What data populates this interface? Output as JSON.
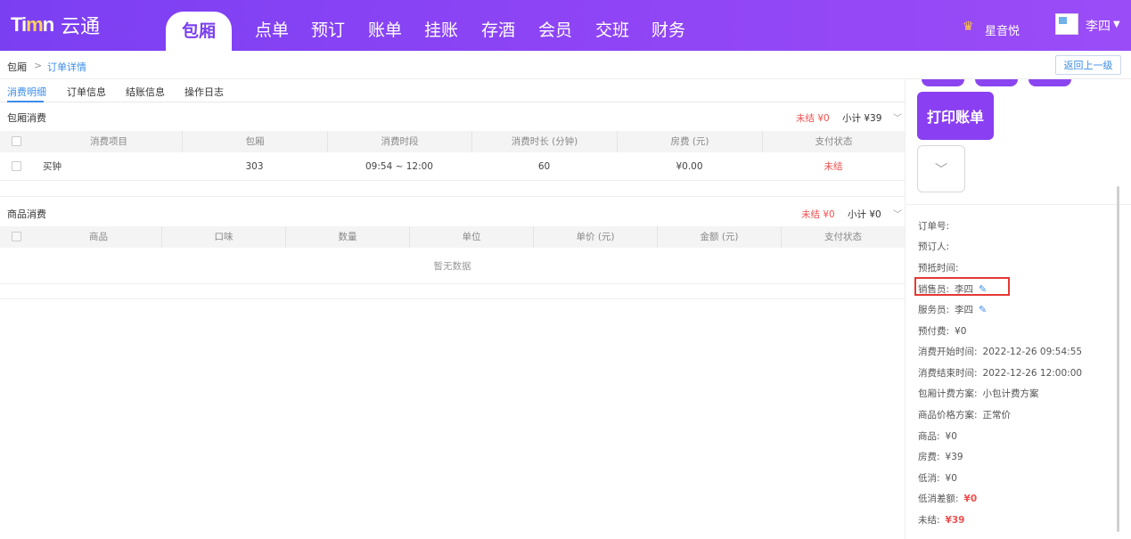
{
  "app": {
    "logo_mark_left": "Ti",
    "logo_mark_mid": "m",
    "logo_mark_right": "n",
    "logo_text": "云通",
    "nav": [
      "包厢",
      "点单",
      "预订",
      "账单",
      "挂账",
      "存酒",
      "会员",
      "交班",
      "财务"
    ],
    "active_nav": "包厢",
    "venue": "星音悦",
    "user": "李四"
  },
  "breadcrumb": {
    "root": "包厢",
    "separator": ">",
    "current": "订单详情",
    "back_label": "返回上一级"
  },
  "tabs": [
    "消费明细",
    "订单信息",
    "结账信息",
    "操作日志"
  ],
  "room_section": {
    "title": "包厢消费",
    "unsettled": "未结 ¥0",
    "subtotal": "小计 ¥39",
    "columns": [
      "消费项目",
      "包厢",
      "消费时段",
      "消费时长 (分钟)",
      "房费 (元)",
      "支付状态"
    ],
    "rows": [
      {
        "item": "买钟",
        "room": "303",
        "period": "09:54 ~ 12:00",
        "duration": "60",
        "fee": "¥0.00",
        "status": "未结"
      }
    ]
  },
  "goods_section": {
    "title": "商品消费",
    "unsettled": "未结 ¥0",
    "subtotal": "小计 ¥0",
    "columns": [
      "商品",
      "口味",
      "数量",
      "单位",
      "单价 (元)",
      "金额 (元)",
      "支付状态"
    ],
    "empty_text": "暂无数据"
  },
  "panel": {
    "print_label": "打印账单",
    "expand_glyph": "﹀",
    "info": [
      {
        "label": "订单号:",
        "value": ""
      },
      {
        "label": "预订人:",
        "value": ""
      },
      {
        "label": "预抵时间:",
        "value": ""
      },
      {
        "label": "销售员:",
        "value": "李四"
      },
      {
        "label": "服务员:",
        "value": "李四"
      },
      {
        "label": "预付费:",
        "value": "¥0"
      },
      {
        "label": "消费开始时间:",
        "value": "2022-12-26 09:54:55"
      },
      {
        "label": "消费结束时间:",
        "value": "2022-12-26 12:00:00"
      },
      {
        "label": "包厢计费方案:",
        "value": "小包计费方案"
      },
      {
        "label": "商品价格方案:",
        "value": "正常价"
      },
      {
        "label": "商品:",
        "value": "¥0"
      },
      {
        "label": "房费:",
        "value": "¥39"
      },
      {
        "label": "低消:",
        "value": "¥0"
      },
      {
        "label": "低消差额:",
        "value": "¥0"
      },
      {
        "label": "未结:",
        "value": "¥39"
      }
    ]
  },
  "colors": {
    "brand": "#8a3ff2",
    "link": "#3c8de8",
    "alert": "#f05050"
  }
}
